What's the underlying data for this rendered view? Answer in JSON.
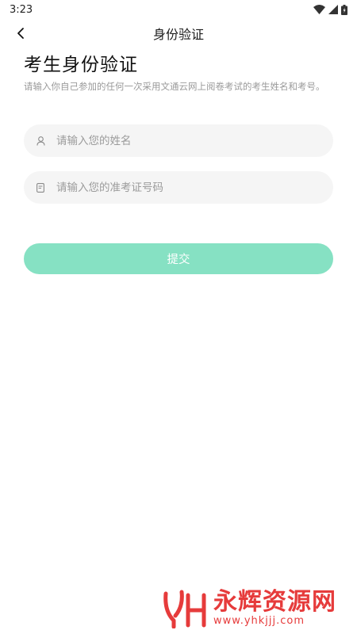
{
  "status_bar": {
    "time": "3:23"
  },
  "nav": {
    "title": "身份验证"
  },
  "page": {
    "heading": "考生身份验证",
    "description": "请输入你自己参加的任何一次采用文通云网上阅卷考试的考生姓名和考号。"
  },
  "form": {
    "name_placeholder": "请输入您的姓名",
    "ticket_placeholder": "请输入您的准考证号码",
    "submit_label": "提交"
  },
  "watermark": {
    "title": "永辉资源网",
    "url": "www.yhkjjj.com"
  },
  "colors": {
    "accent": "#86e1c3",
    "field_bg": "#f5f5f5",
    "watermark": "#e63b3b"
  },
  "icons": [
    "wifi-icon",
    "signal-icon",
    "battery-icon",
    "back-arrow-icon",
    "user-icon",
    "id-card-icon"
  ]
}
